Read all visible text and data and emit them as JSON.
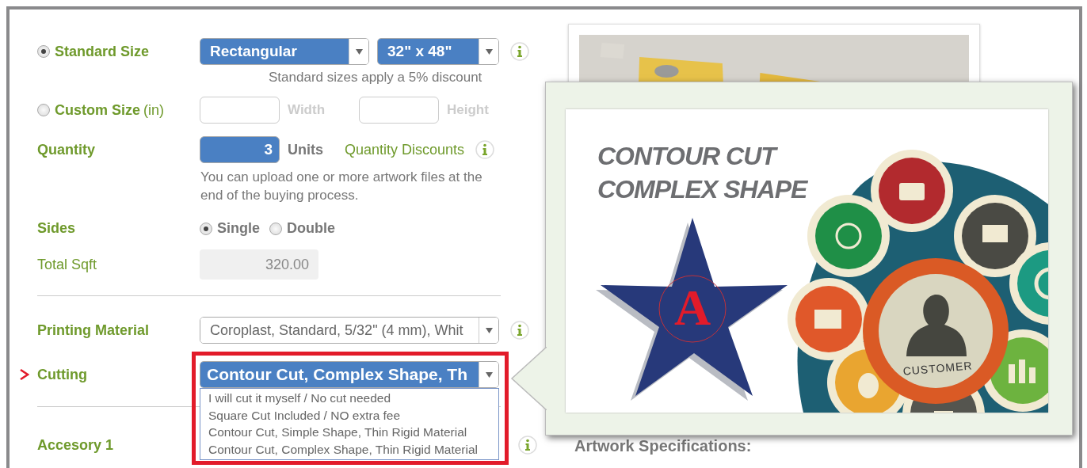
{
  "standard_size": {
    "label": "Standard Size",
    "selected": true,
    "shape": "Rectangular",
    "dimensions": "32\" x 48\"",
    "note": "Standard sizes apply a 5% discount"
  },
  "custom_size": {
    "label": "Custom Size",
    "unit": "(in)",
    "selected": false,
    "width_label": "Width",
    "height_label": "Height"
  },
  "quantity": {
    "label": "Quantity",
    "value": "3",
    "unit": "Units",
    "discounts_link": "Quantity Discounts",
    "note": "You can upload one or more artwork files at the end of the buying process."
  },
  "sides": {
    "label": "Sides",
    "options": [
      {
        "label": "Single",
        "selected": true
      },
      {
        "label": "Double",
        "selected": false
      }
    ]
  },
  "total_sqft": {
    "label": "Total Sqft",
    "value": "320.00"
  },
  "printing_material": {
    "label": "Printing Material",
    "value": "Coroplast, Standard, 5/32\" (4 mm), Whit"
  },
  "cutting": {
    "label": "Cutting",
    "value": "Contour Cut, Complex Shape, Th",
    "options": [
      {
        "label": "I will cut it myself / No cut needed",
        "selected": false
      },
      {
        "label": "Square Cut Included / NO extra fee",
        "selected": false
      },
      {
        "label": "Contour Cut, Simple Shape, Thin Rigid Material",
        "selected": false
      },
      {
        "label": "Contour Cut, Complex Shape, Thin Rigid Material",
        "selected": false
      }
    ]
  },
  "accessory": {
    "label": "Accesory 1"
  },
  "preview": {
    "title_lines": [
      "CONTOUR CUT",
      "COMPLEX SHAPE"
    ],
    "star_letter": "A",
    "center_label": "CUSTOMER"
  },
  "artwork_heading": "Artwork Specifications:"
}
